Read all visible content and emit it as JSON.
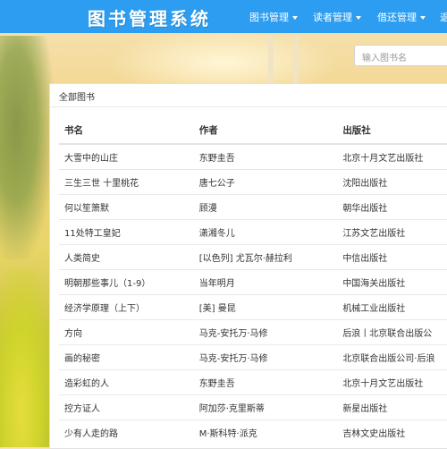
{
  "app": {
    "title": "图书管理系统"
  },
  "nav": {
    "items": [
      {
        "label": "图书管理"
      },
      {
        "label": "读者管理"
      },
      {
        "label": "借还管理"
      },
      {
        "label": "退"
      }
    ]
  },
  "search": {
    "placeholder": "输入图书名"
  },
  "panel": {
    "title": "全部图书"
  },
  "table": {
    "headers": [
      "书名",
      "作者",
      "出版社"
    ],
    "rows": [
      [
        "大雪中的山庄",
        "东野圭吾",
        "北京十月文艺出版社"
      ],
      [
        "三生三世 十里桃花",
        "唐七公子",
        "沈阳出版社"
      ],
      [
        "何以笙箫默",
        "顾漫",
        "朝华出版社"
      ],
      [
        "11处特工皇妃",
        "潇湘冬儿",
        "江苏文艺出版社"
      ],
      [
        "人类简史",
        "[以色列] 尤瓦尔·赫拉利",
        "中信出版社"
      ],
      [
        "明朝那些事儿（1-9）",
        "当年明月",
        "中国海关出版社"
      ],
      [
        "经济学原理（上下）",
        "[美] 曼昆",
        "机械工业出版社"
      ],
      [
        "方向",
        "马克-安托万·马修",
        "后浪丨北京联合出版公"
      ],
      [
        "画的秘密",
        "马克-安托万·马修",
        "北京联合出版公司·后浪"
      ],
      [
        "造彩虹的人",
        "东野圭吾",
        "北京十月文艺出版社"
      ],
      [
        "控方证人",
        "阿加莎·克里斯蒂",
        "新星出版社"
      ],
      [
        "少有人走的路",
        "M·斯科特·派克",
        "吉林文史出版社"
      ]
    ]
  },
  "colors": {
    "navbar": "#2c9df0",
    "panel": "#ffffff"
  }
}
